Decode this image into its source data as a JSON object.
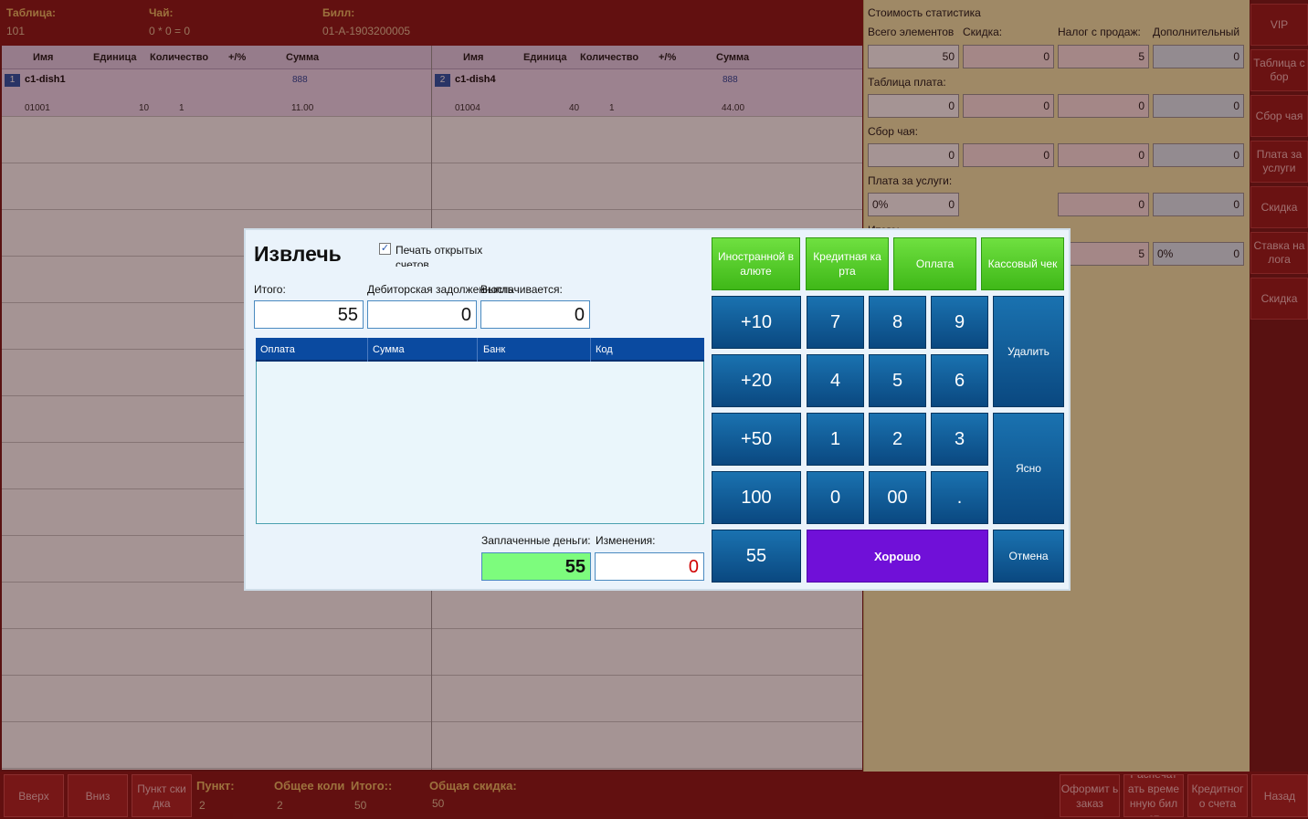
{
  "topbar": {
    "table_label": "Таблица:",
    "table_value": "101",
    "tea_label": "Чай:",
    "tea_value": "0 * 0 = 0",
    "bill_label": "Билл:",
    "bill_value": "01-A-1903200005"
  },
  "columns": {
    "headers": [
      "Имя",
      "Единица",
      "Количество",
      "+/%",
      "Сумма"
    ],
    "left": {
      "num": "1",
      "name": "c1-dish1",
      "price": "888",
      "code": "01001",
      "unit": "10",
      "qty": "1",
      "sum": "11.00"
    },
    "right": {
      "num": "2",
      "name": "c1-dish4",
      "price": "888",
      "code": "01004",
      "unit": "40",
      "qty": "1",
      "sum": "44.00"
    }
  },
  "stats": {
    "title": "Стоимость статистика",
    "headers": [
      "Всего элементов",
      "Скидка:",
      "Налог с продаж:",
      "Дополнительный"
    ],
    "row1": [
      "50",
      "0",
      "5",
      "0"
    ],
    "table_fee_label": "Таблица плата:",
    "row2": [
      "0",
      "0",
      "0",
      "0"
    ],
    "tea_fee_label": "Сбор чая:",
    "row3": [
      "0",
      "0",
      "0",
      "0"
    ],
    "service_label": "Плата за услуги:",
    "row4_pct": "0%",
    "row4": [
      "0",
      "0",
      "0"
    ],
    "total_label": "Итого:",
    "row5": [
      "5",
      "0%",
      "0"
    ]
  },
  "side_buttons": [
    "VIP",
    "Таблица с бор",
    "Сбор чая",
    "Плата за услуги",
    "Скидка",
    "Ставка на лога",
    "Скидка"
  ],
  "bottom": {
    "up": "Вверх",
    "down": "Вниз",
    "discount_item": "Пункт ски дка",
    "item_label": "Пункт:",
    "item_value": "2",
    "total_qty_label": "Общее коли",
    "total_qty_value": "2",
    "total_label": "Итого::",
    "total_value": "50",
    "total_discount_label": "Общая скидка:",
    "total_discount_value": "50",
    "place_order": "Оформит ь заказ",
    "print_temp": "Распечат ать време нную бил ет",
    "credit_bill": "Кредитног о счета",
    "back": "Назад"
  },
  "dialog": {
    "title": "Извлечь",
    "print_label": "Печать открытых счетов",
    "total_label": "Итого:",
    "total_value": "55",
    "debt_label": "Дебиторская задолженность",
    "debt_value": "0",
    "paying_label": "Выплачивается:",
    "paying_value": "0",
    "table_headers": [
      "Оплата",
      "Сумма",
      "Банк",
      "Код"
    ],
    "paid_label": "Заплаченные деньги:",
    "paid_value": "55",
    "change_label": "Изменения:",
    "change_value": "0",
    "pay_buttons": [
      "Иностранной в алюте",
      "Кредитная ка рта",
      "Оплата",
      "Кассовый чек"
    ],
    "keys": {
      "p10": "+10",
      "p20": "+20",
      "p50": "+50",
      "k100": "100",
      "k55": "55",
      "k7": "7",
      "k8": "8",
      "k9": "9",
      "k4": "4",
      "k5": "5",
      "k6": "6",
      "k1": "1",
      "k2": "2",
      "k3": "3",
      "k0": "0",
      "k00": "00",
      "kdot": ".",
      "delete": "Удалить",
      "clear": "Ясно",
      "ok": "Хорошо",
      "cancel": "Отмена"
    }
  },
  "colors": {
    "accent_green": "#4cc81f",
    "key_blue": "#0d5a94",
    "ok_purple": "#7010d8",
    "paid_green": "#7dfc7d",
    "change_red": "#d00000"
  }
}
